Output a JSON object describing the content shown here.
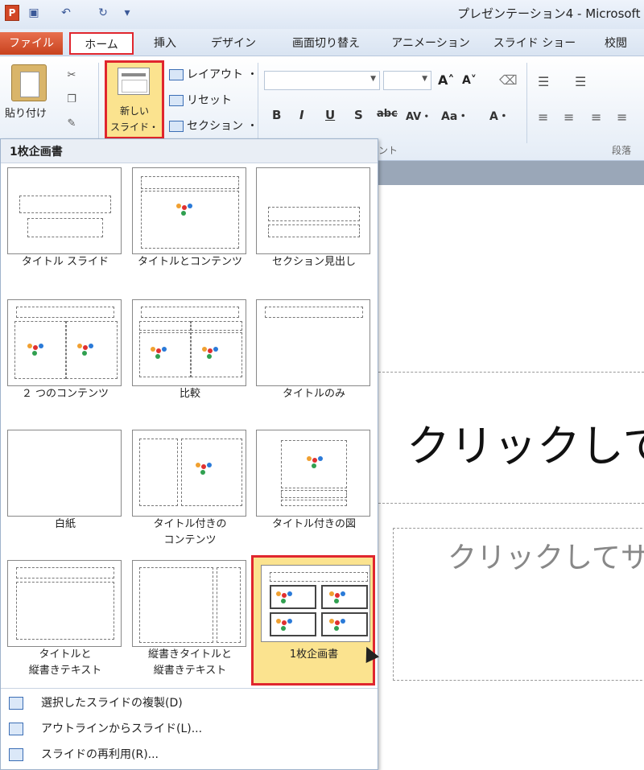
{
  "app": {
    "title": "プレゼンテーション4 - Microsoft"
  },
  "tabs": [
    "ファイル",
    "ホーム",
    "挿入",
    "デザイン",
    "画面切り替え",
    "アニメーション",
    "スライド ショー",
    "校閲"
  ],
  "ribbon": {
    "paste": "貼り付け",
    "new_slide": "新しい\nスライド・",
    "layout": "レイアウト ・",
    "reset": "リセット",
    "section": "セクション ・",
    "font_buttons": [
      "B",
      "I",
      "U",
      "S",
      "abc",
      "AV・",
      "Aa・",
      "A・"
    ],
    "font_group": "ント",
    "paragraph_group": "段落"
  },
  "gallery": {
    "title": "1枚企画書",
    "layouts": [
      {
        "label": "タイトル スライド"
      },
      {
        "label": "タイトルとコンテンツ"
      },
      {
        "label": "セクション見出し"
      },
      {
        "label": "２ つのコンテンツ"
      },
      {
        "label": "比較"
      },
      {
        "label": "タイトルのみ"
      },
      {
        "label": "白紙"
      },
      {
        "label": "タイトル付きの\nコンテンツ"
      },
      {
        "label": "タイトル付きの図"
      },
      {
        "label": "タイトルと\n縦書きテキスト"
      },
      {
        "label": "縦書きタイトルと\n縦書きテキスト"
      },
      {
        "label": "1枚企画書"
      }
    ],
    "selected": "1枚企画書"
  },
  "menu": {
    "items": [
      "選択したスライドの複製(D)",
      "アウトラインからスライド(L)...",
      "スライドの再利用(R)..."
    ]
  },
  "slide": {
    "title_placeholder": "クリックして",
    "subtitle_placeholder": "クリックしてサ"
  },
  "colors": {
    "highlight_border": "#e0262e",
    "selected_fill": "#fbe38f",
    "file_tab": "#c8421e"
  }
}
